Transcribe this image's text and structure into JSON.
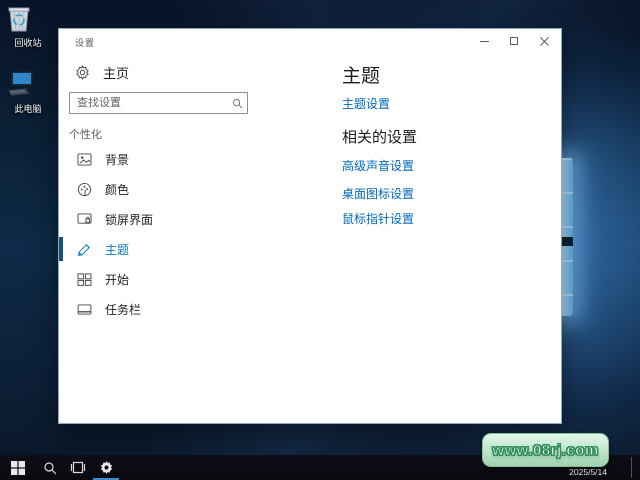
{
  "desktop": {
    "icons": [
      {
        "label": "回收站"
      },
      {
        "label": "此电脑"
      }
    ]
  },
  "window": {
    "title": "设置"
  },
  "sidebar": {
    "home_label": "主页",
    "search_placeholder": "查找设置",
    "section_label": "个性化",
    "items": [
      {
        "label": "背景",
        "selected": false
      },
      {
        "label": "颜色",
        "selected": false
      },
      {
        "label": "锁屏界面",
        "selected": false
      },
      {
        "label": "主题",
        "selected": true
      },
      {
        "label": "开始",
        "selected": false
      },
      {
        "label": "任务栏",
        "selected": false
      }
    ]
  },
  "content": {
    "page_title": "主题",
    "theme_settings_link": "主题设置",
    "related_heading": "相关的设置",
    "related_links": [
      {
        "label": "高级声音设置"
      },
      {
        "label": "桌面图标设置"
      },
      {
        "label": "鼠标指针设置"
      }
    ]
  },
  "taskbar": {
    "date": "2025/5/14"
  },
  "watermark": {
    "text": "www.08rj.com"
  },
  "colors": {
    "accent": "#0078d7",
    "link_blue": "#0069b9",
    "selected_text": "#0c7bbf",
    "selected_bar": "#12527c",
    "watermark_green": "#2f8f5a",
    "taskbar_bg": "#0d0e16"
  }
}
